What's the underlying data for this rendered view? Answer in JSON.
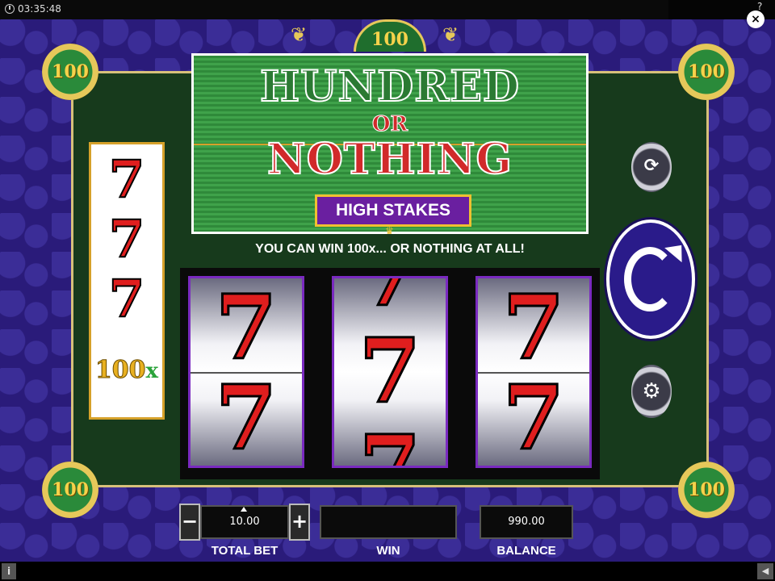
{
  "status_bar": {
    "time": "03:35:48"
  },
  "header": {
    "crest_value": "100",
    "corner_value": "100"
  },
  "title": {
    "line1": "HUNDRED",
    "line2": "OR",
    "line3": "NOTHING",
    "badge": "HIGH STAKES"
  },
  "tagline": "YOU CAN WIN 100x... OR NOTHING AT ALL!",
  "paytable": {
    "symbol": "7",
    "multiplier": "100",
    "multiplier_suffix": "x"
  },
  "reels": {
    "symbol": "7"
  },
  "controls": {
    "minus": "−",
    "plus": "+",
    "close": "×",
    "help": "?"
  },
  "fields": {
    "total_bet_value": "10.00",
    "total_bet_label": "TOTAL BET",
    "win_value": "",
    "win_label": "WIN",
    "balance_value": "990.00",
    "balance_label": "BALANCE"
  },
  "footer": {
    "info": "i",
    "sound": "◀"
  },
  "colors": {
    "background": "#2a1b7a",
    "board": "#173a1c",
    "accent_gold": "#d6a12a",
    "seven_red": "#e01e1e"
  },
  "icons": [
    "clock-icon",
    "close-icon",
    "help-icon",
    "autoplay-icon",
    "spin-icon",
    "settings-gear-icon",
    "crown-icon",
    "info-icon",
    "sound-icon"
  ]
}
